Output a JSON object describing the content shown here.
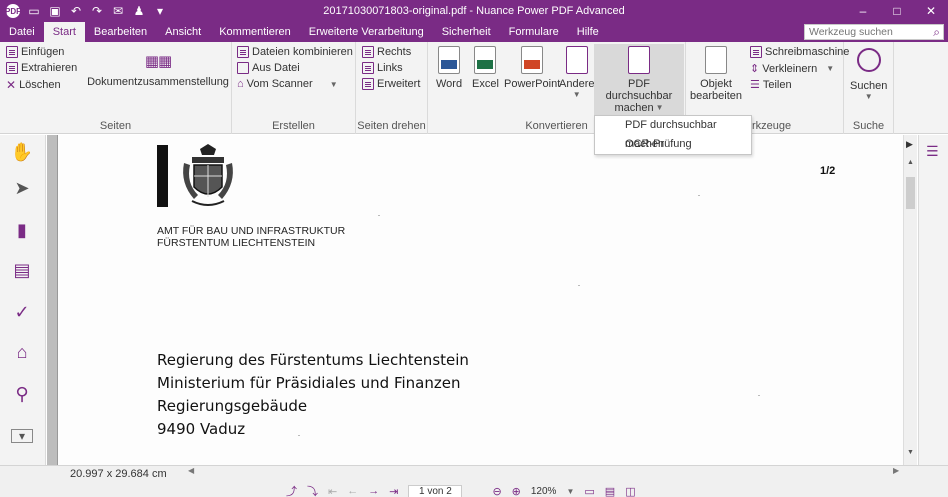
{
  "window": {
    "title": "20171030071803-original.pdf - Nuance Power PDF Advanced",
    "logo": "PDF",
    "quick_access_icons": [
      "open-icon",
      "save-icon",
      "undo-icon",
      "redo-icon",
      "email-icon",
      "stamp-icon",
      "customize-icon"
    ],
    "controls": [
      "minimize-icon",
      "maximize-icon",
      "close-icon"
    ]
  },
  "menu": {
    "tabs": [
      "Datei",
      "Start",
      "Bearbeiten",
      "Ansicht",
      "Kommentieren",
      "Erweiterte Verarbeitung",
      "Sicherheit",
      "Formulare",
      "Hilfe"
    ],
    "active_tab": "Start",
    "search_placeholder": "Werkzeug suchen"
  },
  "ribbon": {
    "seiten": {
      "label": "Seiten",
      "einfuegen": "Einfügen",
      "extrahieren": "Extrahieren",
      "loeschen": "Löschen",
      "dokumentzusammenstellung": "Dokumentzusammenstellung"
    },
    "erstellen": {
      "label": "Erstellen",
      "kombinieren": "Dateien kombinieren",
      "aus_datei": "Aus Datei",
      "vom_scanner": "Vom Scanner"
    },
    "seiten_drehen": {
      "label": "Seiten drehen",
      "rechts": "Rechts",
      "links": "Links",
      "erweitert": "Erweitert"
    },
    "konvertieren": {
      "label": "Konvertieren",
      "word": "Word",
      "excel": "Excel",
      "powerpoint": "PowerPoint",
      "andere": "Andere",
      "pdf_line1": "PDF durchsuchbar",
      "pdf_line2": "machen"
    },
    "werkzeuge": {
      "label_partial": "rkzeuge",
      "objekt_line1": "Objekt",
      "objekt_line2": "bearbeiten",
      "schreibmaschine": "Schreibmaschine",
      "verkleinern": "Verkleinern",
      "teilen": "Teilen"
    },
    "suche": {
      "label": "Suche",
      "suchen": "Suchen"
    }
  },
  "dropdown": {
    "items": [
      "PDF durchsuchbar machen",
      "OCR-Prüfung"
    ]
  },
  "document": {
    "page_indicator": "1/2",
    "authority_line1": "AMT FÜR BAU UND INFRASTRUKTUR",
    "authority_line2": "FÜRSTENTUM LIECHTENSTEIN",
    "address": [
      "Regierung des Fürstentums Liechtenstein",
      "Ministerium für Präsidiales und Finanzen",
      "Regierungsgebäude",
      "9490 Vaduz"
    ]
  },
  "statusbar": {
    "dimensions": "20.997 x 29.684 cm",
    "page_field": "1 von 2",
    "zoom": "120%"
  },
  "colors": {
    "accent": "#7a2b85",
    "ribbon_bg": "#f3f3f3"
  }
}
